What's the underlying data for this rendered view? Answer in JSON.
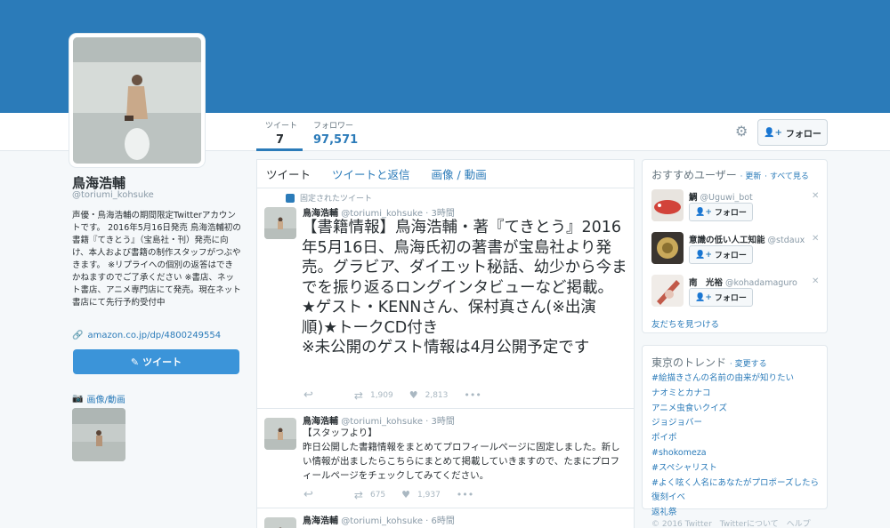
{
  "profile": {
    "name": "鳥海浩輔",
    "handle": "@toriumi_kohsuke",
    "bio": "声優・鳥海浩輔の期間限定Twitterアカウントです。 2016年5月16日発売 鳥海浩輔初の書籍『てきとう』（宝島社・刊）発売に向け、本人および書籍の制作スタッフがつぶやきます。 ※リプライへの個別の返答はできかねますのでご了承ください ※書店、ネット書店、アニメ専門店にて発売。現在ネット書店にて先行予約受付中",
    "link": "amazon.co.jp/dp/4800249554",
    "tweet_button": "ツイート",
    "media_heading": "画像/動画"
  },
  "stats": {
    "tweets_label": "ツイート",
    "tweets_value": "7",
    "followers_label": "フォロワー",
    "followers_value": "97,571"
  },
  "follow_button": "フォロー",
  "tabs": [
    "ツイート",
    "ツイートと返信",
    "画像 / 動画"
  ],
  "tweets": [
    {
      "pinned_label": "固定されたツイート",
      "name": "鳥海浩輔",
      "handle_time": "@toriumi_kohsuke · 3時間",
      "text": "【書籍情報】鳥海浩輔・著『てきとう』2016年5月16日、鳥海氏初の著書が宝島社より発売。グラビア、ダイエット秘話、幼少から今までを振り返るロングインタビューなど掲載。\n★ゲスト・KENNさん、保村真さん(※出演順)★トークCD付き\n※未公開のゲスト情報は4月公開予定です",
      "retweets": "1,909",
      "likes": "2,813"
    },
    {
      "name": "鳥海浩輔",
      "handle_time": "@toriumi_kohsuke · 3時間",
      "text": "【スタッフより】\n昨日公開した書籍情報をまとめてプロフィールページに固定しました。新しい情報が出ましたらこちらにまとめて掲載していきますので、たまにプロフィールページをチェックしてみてください。",
      "retweets": "675",
      "likes": "1,937"
    },
    {
      "name": "鳥海浩輔",
      "handle_time": "@toriumi_kohsuke · 6時間"
    }
  ],
  "suggestions": {
    "title": "おすすめユーザー",
    "refresh": "更新",
    "view_all": "すべて見る",
    "users": [
      {
        "name": "鯛",
        "handle": "@Uguwi_bot"
      },
      {
        "name": "意識の低い人工知能",
        "handle": "@stdaux"
      },
      {
        "name": "南　光裕",
        "handle": "@kohadamaguro"
      }
    ],
    "find_friends": "友だちを見つける"
  },
  "trends": {
    "title": "東京のトレンド",
    "change": "変更する",
    "items": [
      "#絵描きさんの名前の由来が知りたい",
      "ナオミとカナコ",
      "アニメ虫食いクイズ",
      "ジョジョバー",
      "ポイポ",
      "#shokomeza",
      "#スペシャリスト",
      "#よく呟く人名にあなたがプロポーズしたら",
      "復刻イベ",
      "返礼祭"
    ]
  },
  "footer": "© 2016 Twitter　Twitterについて　ヘルプ"
}
